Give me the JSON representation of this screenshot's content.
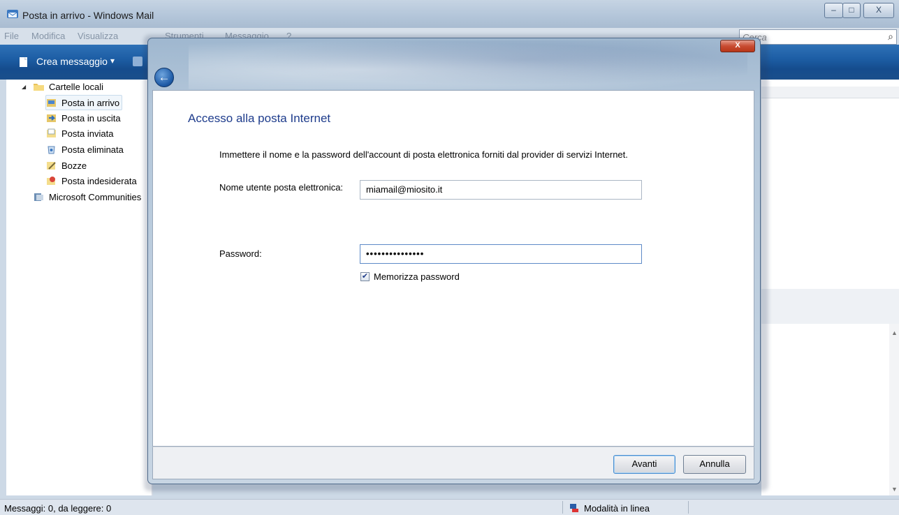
{
  "window": {
    "title": "Posta in arrivo - Windows Mail",
    "minimize": "–",
    "maximize": "□",
    "close": "X"
  },
  "menu": {
    "items": [
      "File",
      "Modifica",
      "Visualizza",
      "Strumenti",
      "Messaggio",
      "?"
    ]
  },
  "search": {
    "placeholder": "Cerca"
  },
  "toolbar": {
    "new_message": "Crea messaggio",
    "dropdown": "▾"
  },
  "folders": {
    "root": "Cartelle locali",
    "items": [
      "Posta in arrivo",
      "Posta in uscita",
      "Posta inviata",
      "Posta eliminata",
      "Bozze",
      "Posta indesiderata"
    ],
    "community": "Microsoft Communities"
  },
  "dialog": {
    "close": "X",
    "heading": "Accesso alla posta Internet",
    "description": "Immettere il nome e la password dell'account di posta elettronica forniti dal provider di servizi Internet.",
    "username_label": "Nome utente posta elettronica:",
    "username_value": "miamail@miosito.it",
    "password_label": "Password:",
    "password_value": "•••••••••••••••",
    "remember_label": "Memorizza password",
    "remember_checked": true,
    "next_button": "Avanti",
    "cancel_button": "Annulla"
  },
  "status": {
    "messages": "Messaggi: 0, da leggere: 0",
    "mode": "Modalità in linea"
  },
  "colors": {
    "toolbar": "#1d5ea5",
    "heading": "#1e3c8c",
    "dialog_frame": "#b4c7da"
  }
}
